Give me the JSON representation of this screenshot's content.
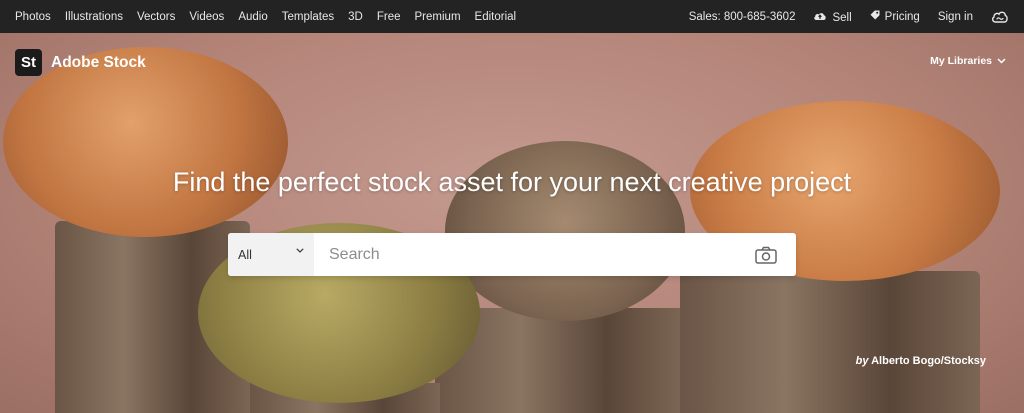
{
  "topbar": {
    "nav_items": [
      "Photos",
      "Illustrations",
      "Vectors",
      "Videos",
      "Audio",
      "Templates",
      "3D",
      "Free",
      "Premium",
      "Editorial"
    ],
    "sales": "Sales: 800-685-3602",
    "sell": "Sell",
    "pricing": "Pricing",
    "signin": "Sign in"
  },
  "brand": {
    "logo_text": "St",
    "name": "Adobe Stock"
  },
  "libraries": "My Libraries",
  "headline": "Find the perfect stock asset for your next creative project",
  "search": {
    "scope": "All",
    "placeholder": "Search"
  },
  "credit": {
    "by": "by",
    "author": "Alberto Bogo/Stocksy"
  },
  "icons": [
    "sell-cloud-icon",
    "pricing-tag-icon",
    "creative-cloud-icon",
    "chevron-down-icon",
    "camera-search-icon"
  ]
}
